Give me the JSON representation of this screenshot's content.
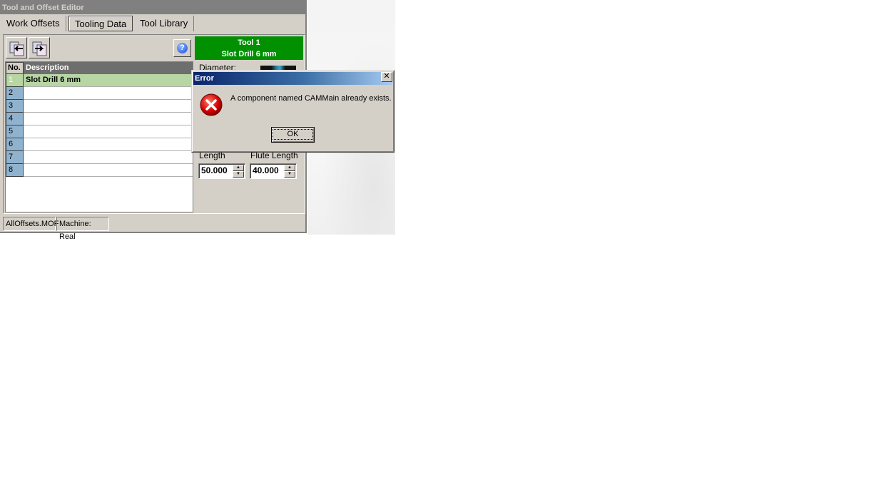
{
  "window": {
    "title": "Tool and Offset Editor",
    "tabs": [
      {
        "label": "Work Offsets"
      },
      {
        "label": "Tooling Data"
      },
      {
        "label": "Tool Library"
      }
    ],
    "toolbar": {
      "import_icon": "import-tools-icon",
      "export_icon": "export-tools-icon",
      "help_glyph": "?"
    },
    "table": {
      "columns": [
        "No.",
        "Description"
      ],
      "rows": [
        {
          "no": "1",
          "description": "Slot Drill 6 mm"
        },
        {
          "no": "2",
          "description": ""
        },
        {
          "no": "3",
          "description": ""
        },
        {
          "no": "4",
          "description": ""
        },
        {
          "no": "5",
          "description": ""
        },
        {
          "no": "6",
          "description": ""
        },
        {
          "no": "7",
          "description": ""
        },
        {
          "no": "8",
          "description": ""
        }
      ]
    },
    "tool_panel": {
      "title_line1": "Tool 1",
      "title_line2": "Slot Drill 6 mm",
      "diameter_label": "Diameter:",
      "length_label": "Length",
      "length_value": "50.000",
      "flute_length_label": "Flute Length",
      "flute_length_value": "40.000"
    },
    "status": {
      "file": "AllOffsets.MOF",
      "machine": "Machine: Real"
    }
  },
  "dialog": {
    "title": "Error",
    "close_glyph": "✕",
    "message": "A component named CAMMain already exists.",
    "ok_label": "OK"
  },
  "colors": {
    "tool_header": "#009000",
    "selected_row": "#b8d6a4",
    "row_number": "#8fb3cf",
    "dialog_title_start": "#0a246a"
  }
}
